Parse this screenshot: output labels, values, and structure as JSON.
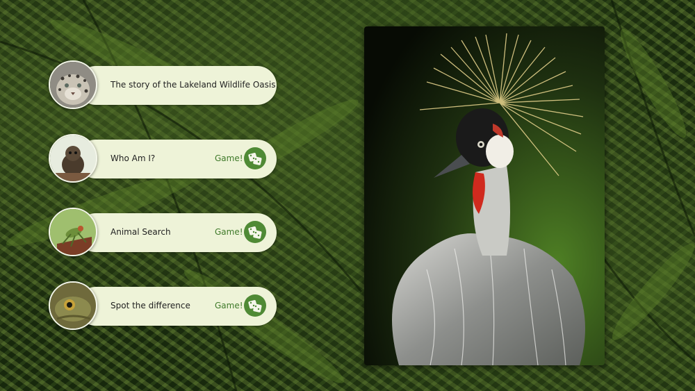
{
  "menu": {
    "items": [
      {
        "label": "The story of the Lakeland Wildlife Oasis",
        "thumb": "snow-leopard",
        "game": ""
      },
      {
        "label": "Who Am I?",
        "thumb": "marmoset",
        "game": "Game!"
      },
      {
        "label": "Animal Search",
        "thumb": "insect",
        "game": "Game!"
      },
      {
        "label": "Spot the difference",
        "thumb": "frog",
        "game": "Game!"
      }
    ]
  },
  "feature_photo": {
    "subject": "grey-crowned-crane"
  },
  "colors": {
    "pill": "#eef3d8",
    "accent": "#4f8a35",
    "game_text": "#3f7a2a"
  }
}
